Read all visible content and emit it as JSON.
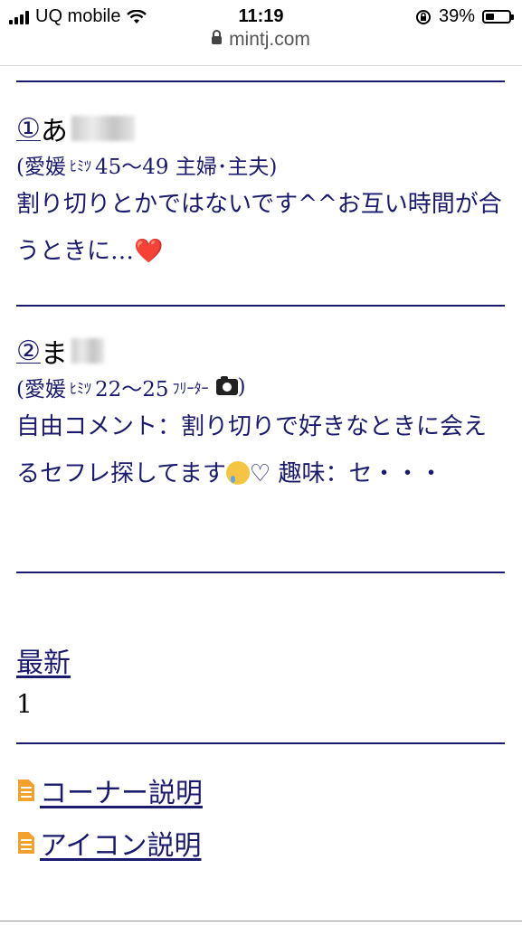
{
  "status_bar": {
    "carrier": "UQ mobile",
    "time": "11:19",
    "battery_percent": "39%",
    "battery_level": 0.39
  },
  "browser": {
    "url": "mintj.com"
  },
  "posts": [
    {
      "number": "①",
      "name": "あ",
      "meta_open": "(愛媛",
      "meta_tag": "ﾋﾐﾂ",
      "meta_rest": "45〜49 主婦･主夫)",
      "body": "割り切りとかではないです^^お互い時間が合うときに…",
      "emoji": "❤️"
    },
    {
      "number": "②",
      "name": "ま",
      "meta_open": "(愛媛",
      "meta_tag": "ﾋﾐﾂ",
      "meta_rest": "22〜25",
      "meta_job": "ﾌﾘｰﾀｰ",
      "meta_close": ")",
      "body_part1": "自由コメント：割り切りで好きなときに会えるセフレ探してます",
      "body_part2": "♡ 趣味：セ・・・"
    }
  ],
  "pagination": {
    "latest_label": "最新",
    "page": "1"
  },
  "nav": [
    {
      "label": "コーナー説明"
    },
    {
      "label": "アイコン説明"
    }
  ],
  "icons": {
    "doc": "document-icon",
    "camera": "camera-icon",
    "heart": "heart-emoji",
    "cry": "crying-face-emoji"
  },
  "colors": {
    "link": "#1a1a6e",
    "divider": "#1a1a6e",
    "doc_icon": "#f3a12d"
  }
}
